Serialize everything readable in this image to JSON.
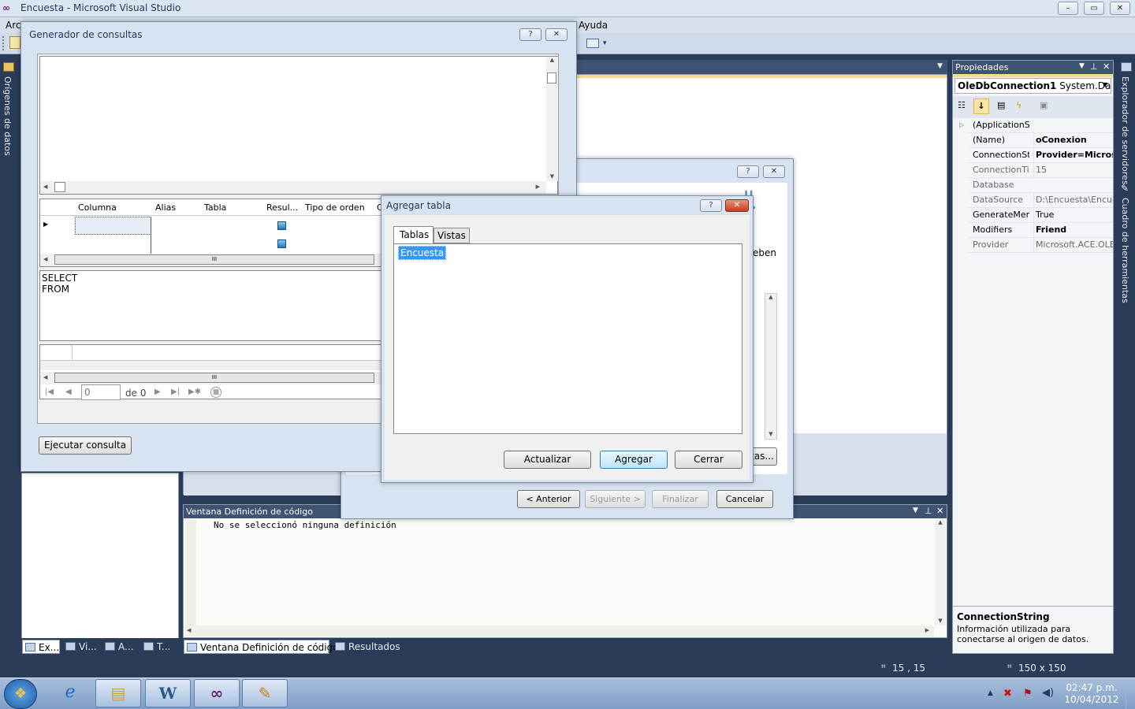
{
  "app": {
    "title": "Encuesta - Microsoft Visual Studio",
    "minimize": "–",
    "restore": "▭",
    "close": "✕"
  },
  "menubar": {
    "partial_left": "Arc",
    "help": "Ayuda"
  },
  "left_strip": {
    "data_sources": "Orígenes de datos"
  },
  "right_strip": {
    "server_explorer": "Explorador de servidores",
    "toolbox": "Cuadro de herramientas"
  },
  "properties": {
    "title": "Propiedades",
    "object_name": "OleDbConnection1",
    "object_type": "System.Data.C",
    "rows": [
      {
        "name": "(ApplicationS",
        "value": "",
        "bold": false,
        "dim": false
      },
      {
        "name": "(Name)",
        "value": "oConexion",
        "bold": true,
        "dim": false
      },
      {
        "name": "ConnectionSt",
        "value": "Provider=Microso",
        "bold": true,
        "dim": false
      },
      {
        "name": "ConnectionTi",
        "value": "15",
        "bold": false,
        "dim": true
      },
      {
        "name": "Database",
        "value": "",
        "bold": false,
        "dim": true
      },
      {
        "name": "DataSource",
        "value": "D:\\Encuesta\\Encue",
        "bold": false,
        "dim": true
      },
      {
        "name": "GenerateMem",
        "value": "True",
        "bold": false,
        "dim": false
      },
      {
        "name": "Modifiers",
        "value": "Friend",
        "bold": true,
        "dim": false
      },
      {
        "name": "Provider",
        "value": "Microsoft.ACE.OLE",
        "bold": false,
        "dim": true
      }
    ],
    "desc_title": "ConnectionString",
    "desc_text": "Información utilizada para conectarse al origen de datos."
  },
  "code_window": {
    "title": "Ventana Definición de código",
    "content": "No se seleccionó ninguna definición"
  },
  "bottom_tabs": {
    "left": [
      "Ex...",
      "Vi...",
      "A...",
      "T..."
    ],
    "code_def": "Ventana Definición de código",
    "results": "Resultados"
  },
  "statusbar": {
    "position": "15 , 15",
    "size": "150 x 150"
  },
  "query_builder": {
    "title": "Generador de consultas",
    "help": "?",
    "close": "✕",
    "columns": [
      "Columna",
      "Alias",
      "Tabla",
      "Resul...",
      "Tipo de orden",
      "C"
    ],
    "sql_select": "SELECT",
    "sql_from": "FROM",
    "nav_position": "0",
    "nav_of": "de 0",
    "execute": "Ejecutar consulta",
    "scroll_grip": "III"
  },
  "wizard": {
    "partial_text": "eben",
    "partial_button": "tas...",
    "help": "?",
    "close": "✕",
    "prev": "< Anterior",
    "next": "Siguiente >",
    "finish": "Finalizar",
    "cancel": "Cancelar"
  },
  "add_table": {
    "title": "Agregar tabla",
    "help": "?",
    "close": "✕",
    "tab_tables": "Tablas",
    "tab_views": "Vistas",
    "items": [
      "Encuesta"
    ],
    "refresh": "Actualizar",
    "add": "Agregar",
    "close_btn": "Cerrar"
  },
  "taskbar": {
    "time": "02:47 p.m.",
    "date": "10/04/2012"
  }
}
